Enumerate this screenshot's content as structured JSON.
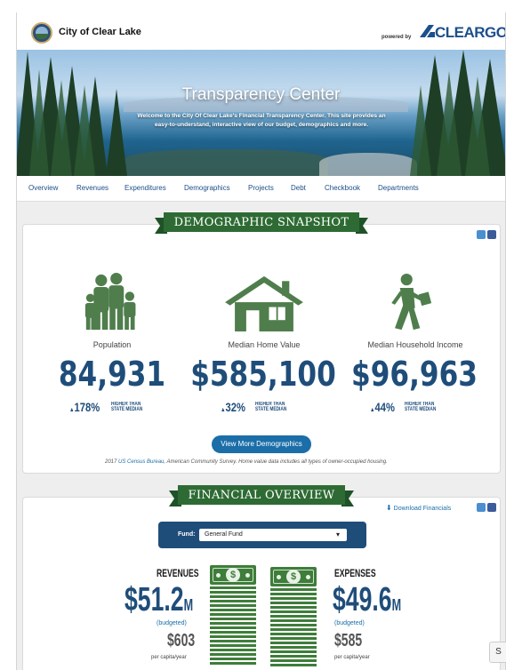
{
  "header": {
    "city_name": "City of Clear Lake",
    "powered_by": "powered by",
    "brand": "CLEARGOV"
  },
  "hero": {
    "title": "Transparency Center",
    "subtitle": "Welcome to the City Of Clear Lake's Financial Transparency Center. This site provides an easy-to-understand, interactive view of our budget, demographics and more."
  },
  "nav": {
    "items": [
      {
        "label": "Overview"
      },
      {
        "label": "Revenues"
      },
      {
        "label": "Expenditures"
      },
      {
        "label": "Demographics"
      },
      {
        "label": "Projects"
      },
      {
        "label": "Debt"
      },
      {
        "label": "Checkbook"
      },
      {
        "label": "Departments"
      }
    ]
  },
  "demographics": {
    "banner": "DEMOGRAPHIC SNAPSHOT",
    "stats": [
      {
        "label": "Population",
        "value": "84,931",
        "pct": "178%",
        "note": "HIGHER THAN STATE MEDIAN",
        "icon": "family-icon"
      },
      {
        "label": "Median Home Value",
        "value": "$585,100",
        "pct": "32%",
        "note": "HIGHER THAN STATE MEDIAN",
        "icon": "house-icon"
      },
      {
        "label": "Median Household Income",
        "value": "$96,963",
        "pct": "44%",
        "note": "HIGHER THAN STATE MEDIAN",
        "icon": "walking-person-icon"
      }
    ],
    "button": "View More Demographics",
    "source_pre": "2017",
    "source_link": "US Census Bureau",
    "source_post": ", American Community Survey. Home value data includes all types of owner-occupied housing."
  },
  "financial": {
    "banner": "FINANCIAL OVERVIEW",
    "download": "Download Financials",
    "fund_label": "Fund:",
    "fund_value": "General Fund",
    "revenues": {
      "head": "REVENUES",
      "value": "$51.2",
      "unit": "M",
      "budgeted": "(budgeted)",
      "per_capita": "$603",
      "per_capita_label": "per capita/year"
    },
    "expenses": {
      "head": "EXPENSES",
      "value": "$49.6",
      "unit": "M",
      "budgeted": "(budgeted)",
      "per_capita": "$585",
      "per_capita_label": "per capita/year"
    }
  },
  "side_tab": "S",
  "colors": {
    "brand_blue": "#1f4d7a",
    "banner_green": "#2e6b34",
    "icon_green": "#4f7e4c",
    "link_blue": "#1b6ea8"
  }
}
